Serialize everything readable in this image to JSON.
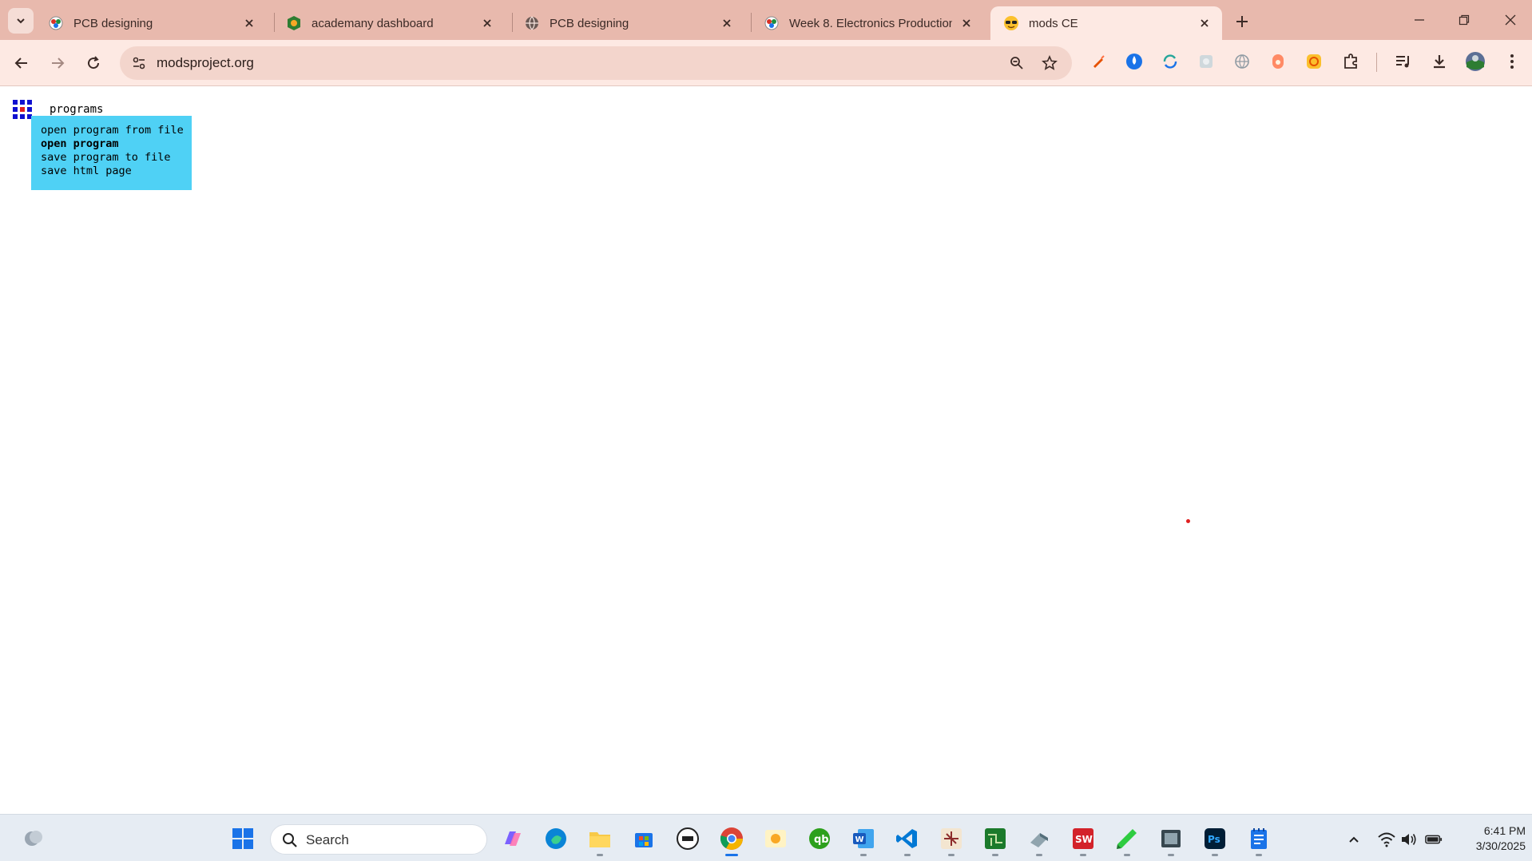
{
  "tabs": [
    {
      "title": "PCB designing",
      "favicon": "fabacademy-icon"
    },
    {
      "title": "academany dashboard",
      "favicon": "academany-icon"
    },
    {
      "title": "PCB designing",
      "favicon": "globe-icon"
    },
    {
      "title": "Week 8. Electronics Production",
      "favicon": "fabacademy-icon"
    },
    {
      "title": "mods CE",
      "favicon": "sunglasses-emoji-icon",
      "active": true
    }
  ],
  "address_bar": {
    "url": "modsproject.org"
  },
  "page": {
    "programs_label": "programs",
    "menu_items": [
      {
        "label": "open program from file",
        "bold": false
      },
      {
        "label": "open program",
        "bold": true
      },
      {
        "label": "save program to file",
        "bold": false
      },
      {
        "label": "save html page",
        "bold": false
      }
    ],
    "menu_color": "#4fd1f5"
  },
  "taskbar": {
    "search_label": "Search",
    "clock_time": "6:41 PM",
    "clock_date": "3/30/2025"
  },
  "colors": {
    "tabstrip": "#e8b9ad",
    "toolbar": "#fde9e3",
    "accent": "#1a73e8"
  }
}
